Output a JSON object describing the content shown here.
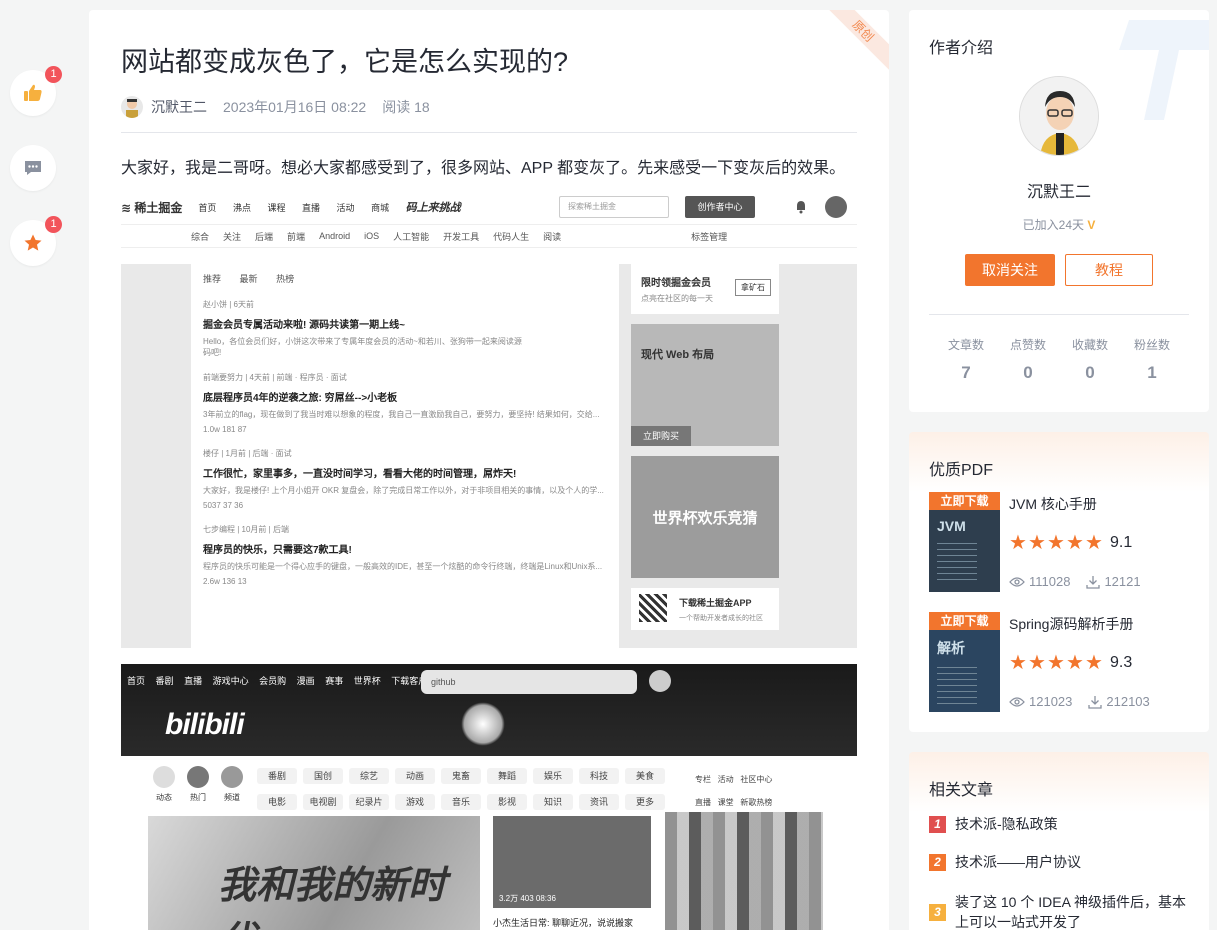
{
  "side_actions": {
    "like_count": "1",
    "star_count": "1"
  },
  "article": {
    "ribbon": "原创",
    "title": "网站都变成灰色了，它是怎么实现的?",
    "author": "沉默王二",
    "date": "2023年01月16日 08:22",
    "reads": "阅读 18",
    "intro": "大家好，我是二哥呀。想必大家都感受到了，很多网站、APP 都变灰了。先来感受一下变灰后的效果。"
  },
  "juejin_shot": {
    "logo": "稀土掘金",
    "nav": [
      "首页",
      "沸点",
      "课程",
      "直播",
      "活动",
      "商城"
    ],
    "campaign": "码上来挑战",
    "search_placeholder": "探索稀土掘金",
    "create_btn": "创作者中心",
    "subnav": [
      "综合",
      "关注",
      "后端",
      "前端",
      "Android",
      "iOS",
      "人工智能",
      "开发工具",
      "代码人生",
      "阅读"
    ],
    "tag_manage": "标签管理",
    "tabs": [
      "推荐",
      "最新",
      "热榜"
    ],
    "feed": [
      {
        "meta": "赵小饼 | 6天前",
        "title": "掘金会员专属活动来啦! 源码共读第一期上线~",
        "desc": "Hello，各位会员们好，小饼这次带来了专属年度会员的活动~和若川、张狗带一起来阅读源码吧!"
      },
      {
        "meta": "前端要努力 | 4天前 | 前端 · 程序员 · 面试",
        "title": "底层程序员4年的逆袭之旅: 穷屌丝-->小老板",
        "desc": "3年前立的flag，现在做到了我当时难以想象的程度，我自己一直激励我自己，要努力，要坚持! 结果如何，交给...",
        "stats": "1.0w   181   87"
      },
      {
        "meta": "楼仔 | 1月前 | 后端 · 面试",
        "title": "工作很忙，家里事多，一直没时间学习，看看大佬的时间管理，屌炸天!",
        "desc": "大家好，我是楼仔! 上个月小姐开 OKR 复盘会，除了完成日常工作以外，对于非项目相关的事情，以及个人的学...",
        "stats": "5037   37   36"
      },
      {
        "meta": "七步编程 | 10月前 | 后端",
        "title": "程序员的快乐，只需要这7款工具!",
        "desc": "程序员的快乐可能是一个得心应手的键盘，一般高效的IDE，甚至一个炫酷的命令行终端，终端是Linux和Unix系...",
        "stats": "2.6w   136   13"
      }
    ],
    "aside_member": "限时领掘金会员",
    "aside_member_sub": "点亮在社区的每一天",
    "aside_member_btn": "拿矿石",
    "aside_ad1_title": "现代 Web 布局",
    "aside_ad1_btn": "立即购买",
    "aside_ad2_title": "世界杯欢乐竞猜",
    "aside_app": "下载稀土掘金APP",
    "aside_app_sub": "一个帮助开发者成长的社区"
  },
  "bili_shot": {
    "topnav": [
      "首页",
      "番剧",
      "直播",
      "游戏中心",
      "会员购",
      "漫画",
      "赛事",
      "世界杯",
      "下载客户端"
    ],
    "search_value": "github",
    "logo": "bilibili",
    "icon_labels": [
      "动态",
      "热门",
      "频道"
    ],
    "categories": [
      "番剧",
      "国创",
      "综艺",
      "动画",
      "鬼畜",
      "舞蹈",
      "娱乐",
      "科技",
      "美食",
      "电影",
      "电视剧",
      "纪录片",
      "游戏",
      "音乐",
      "影视",
      "知识",
      "资讯",
      "更多"
    ],
    "right_links": [
      "专栏",
      "活动",
      "社区中心",
      "直播",
      "课堂",
      "新歌热榜"
    ],
    "hero_text": "我和我的新时代",
    "video_caption": "小杰生活日常: 聊聊近况，说说搬家",
    "video_stats": "3.2万   403   08:36"
  },
  "author_card": {
    "title": "作者介绍",
    "name": "沉默王二",
    "joined": "已加入24天",
    "unfollow_btn": "取消关注",
    "tutorial_btn": "教程",
    "stats": [
      {
        "label": "文章数",
        "value": "7"
      },
      {
        "label": "点赞数",
        "value": "0"
      },
      {
        "label": "收藏数",
        "value": "0"
      },
      {
        "label": "粉丝数",
        "value": "1"
      }
    ]
  },
  "pdf_card": {
    "title": "优质PDF",
    "items": [
      {
        "tag": "立即下载",
        "cover_title": "JVM",
        "name": "JVM 核心手册",
        "score": "9.1",
        "views": "111028",
        "downloads": "12121",
        "rating": 5
      },
      {
        "tag": "立即下载",
        "cover_title": "解析",
        "name": "Spring源码解析手册",
        "score": "9.3",
        "views": "121023",
        "downloads": "212103",
        "rating": 5
      }
    ]
  },
  "related_card": {
    "title": "相关文章",
    "items": [
      {
        "idx": "1",
        "text": "技术派-隐私政策",
        "color": "#e04f4f"
      },
      {
        "idx": "2",
        "text": "技术派——用户协议",
        "color": "#f2752d"
      },
      {
        "idx": "3",
        "text": "装了这 10 个 IDEA 神级插件后，基本上可以一站式开发了",
        "color": "#f6b03e"
      }
    ]
  },
  "colors": {
    "accent": "#f2752d",
    "badge": "#f2545b",
    "like_icon": "#f6b03e",
    "star_icon": "#f2752d"
  }
}
